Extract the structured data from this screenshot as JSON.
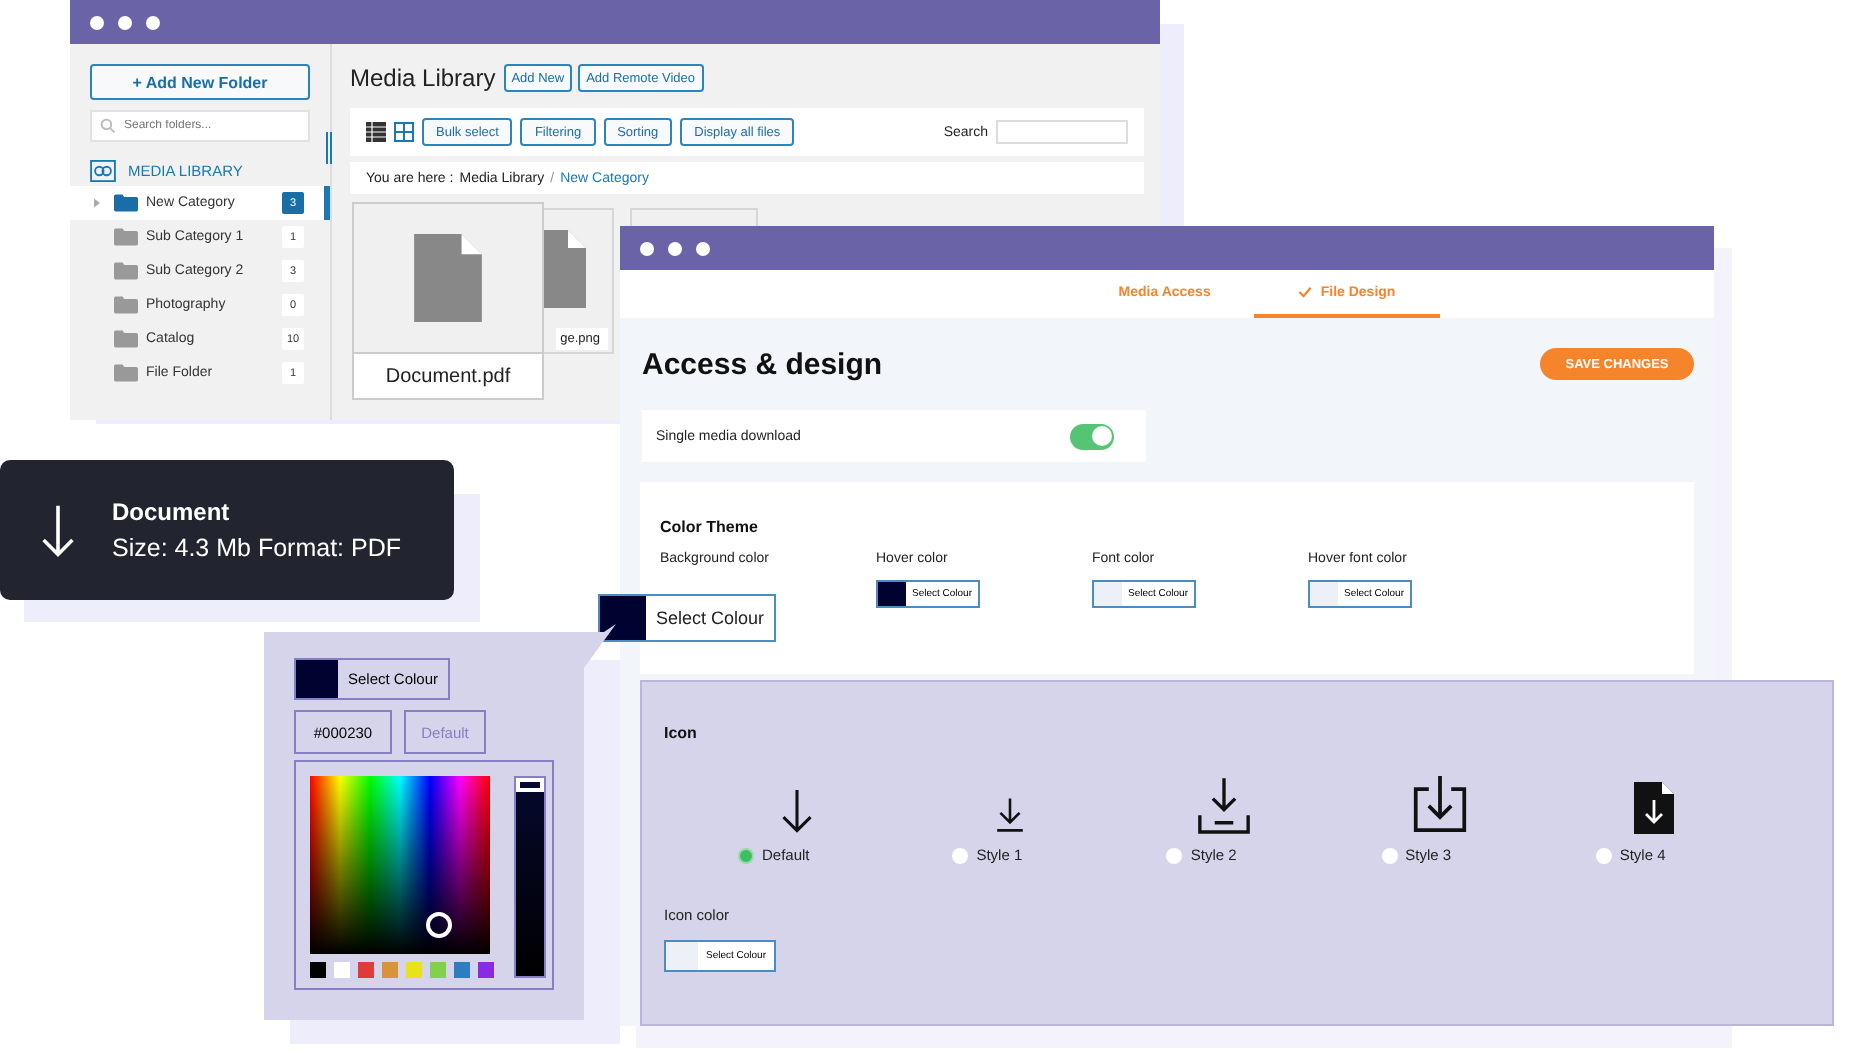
{
  "media_library_window": {
    "sidebar": {
      "add_folder_button": "+ Add New Folder",
      "search_placeholder": "Search folders...",
      "library_heading": "MEDIA LIBRARY",
      "folders": [
        {
          "label": "New Category",
          "count": "3",
          "selected": true,
          "expandable": true
        },
        {
          "label": "Sub Category 1",
          "count": "1",
          "selected": false,
          "expandable": false
        },
        {
          "label": "Sub Category 2",
          "count": "3",
          "selected": false,
          "expandable": false
        },
        {
          "label": "Photography",
          "count": "0",
          "selected": false,
          "expandable": false
        },
        {
          "label": "Catalog",
          "count": "10",
          "selected": false,
          "expandable": false
        },
        {
          "label": "File Folder",
          "count": "1",
          "selected": false,
          "expandable": false
        }
      ]
    },
    "title": "Media Library",
    "header_buttons": [
      "Add New",
      "Add Remote Video"
    ],
    "toolbar_buttons": [
      "Bulk select",
      "Filtering",
      "Sorting",
      "Display all files"
    ],
    "search_label": "Search",
    "breadcrumb": {
      "prefix": "You are here :",
      "items": [
        {
          "label": "Media Library",
          "current": false
        },
        {
          "label": "New Category",
          "current": true
        }
      ],
      "separator": "/"
    },
    "files": [
      {
        "name": "Document.pdf"
      },
      {
        "name": "ge.png"
      }
    ]
  },
  "download_tooltip": {
    "title": "Document",
    "details": "Size: 4.3 Mb Format: PDF"
  },
  "settings_window": {
    "tabs": [
      {
        "label": "Media Access",
        "selected": false
      },
      {
        "label": "File Design",
        "selected": true
      }
    ],
    "heading": "Access & design",
    "save_button": "SAVE CHANGES",
    "single_download": {
      "label": "Single media download",
      "on": true
    },
    "color_theme": {
      "title": "Color Theme",
      "items": [
        {
          "label": "Background color",
          "button": "Select Colour",
          "color": "#000230"
        },
        {
          "label": "Hover color",
          "button": "Select Colour",
          "color": "#000230"
        },
        {
          "label": "Font color",
          "button": "Select Colour",
          "color": "#eef0f8"
        },
        {
          "label": "Hover font color",
          "button": "Select Colour",
          "color": "#eef0f8"
        }
      ]
    },
    "icon_panel": {
      "title": "Icon",
      "options": [
        {
          "kind": "arrow",
          "label": "Default",
          "selected": true
        },
        {
          "kind": "tray-line",
          "label": "Style 1",
          "selected": false
        },
        {
          "kind": "tray",
          "label": "Style 2",
          "selected": false
        },
        {
          "kind": "box",
          "label": "Style 3",
          "selected": false
        },
        {
          "kind": "file",
          "label": "Style 4",
          "selected": false
        }
      ],
      "color_label": "Icon color",
      "color_button": "Select Colour",
      "color": "#eef0f8"
    }
  },
  "color_picker": {
    "button": "Select Colour",
    "hex": "#000230",
    "default_button": "Default",
    "brightness": {
      "level": 1
    },
    "presets": [
      {
        "color": "#000000"
      },
      {
        "color": "#ffffff"
      },
      {
        "color": "#e03a3a"
      },
      {
        "color": "#d8943b"
      },
      {
        "color": "#e9e21b"
      },
      {
        "color": "#82d14a"
      },
      {
        "color": "#2b7ec0"
      },
      {
        "color": "#8a2be2"
      }
    ]
  }
}
